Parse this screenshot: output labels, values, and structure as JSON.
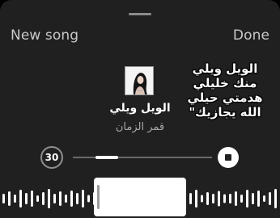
{
  "header": {
    "new_song_label": "New song",
    "done_label": "Done"
  },
  "song": {
    "title": "الويل ويلي",
    "artist": "قمر الزمان"
  },
  "lyrics": {
    "lines": [
      "الويل ويلي",
      "منك خليلي",
      "هدمتي حيلي",
      "الله يجازيك\""
    ]
  },
  "player": {
    "duration_label": "30",
    "progress_fraction": 0.16
  },
  "colors": {
    "sheet_bg": "#202020",
    "accent": "#ffffff",
    "muted_text": "#a6a6a6"
  },
  "icons": {
    "stop": "stop-icon",
    "cover": "album-cover"
  }
}
